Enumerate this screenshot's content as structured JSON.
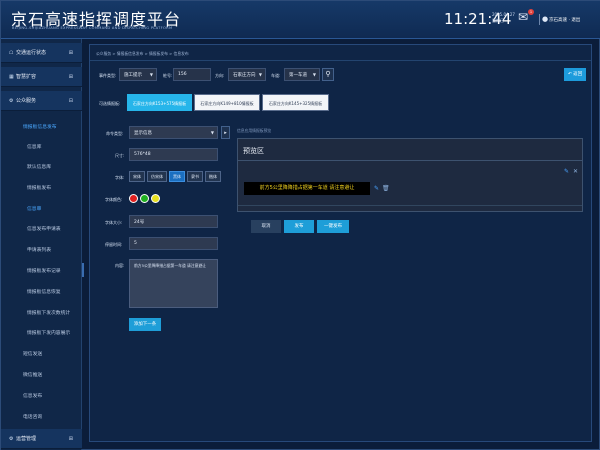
{
  "header": {
    "title": "京石高速指挥调度平台",
    "subtitle": "BEIJING-SHIJIAZHUANG EXPRESSWAY COMMAND AND DISPATCHING PLATFORM",
    "time": "11:21:44",
    "date": "2025.04.27",
    "weekday": "星期日",
    "notification_count": "1",
    "user": "京石高速",
    "logout": "退出"
  },
  "sidebar": {
    "top_items": [
      {
        "icon": "home-icon",
        "label": "交通运行状态",
        "toggle": "⊞"
      },
      {
        "icon": "grid-icon",
        "label": "智慧扩容",
        "toggle": "⊞"
      },
      {
        "icon": "service-icon",
        "label": "公众服务",
        "toggle": "⊟"
      }
    ],
    "section_head": "情报板信息发布",
    "sub_items": [
      "信息库",
      "默认信息库",
      "情报板发布",
      "信息审",
      "信息发布申请表",
      "申请表列表",
      "情报板发布记录",
      "情报板信息恢复",
      "情报板下发次数统计",
      "情报板下发内容展示"
    ],
    "items2": [
      "短信发送",
      "微信推送",
      "信息发布",
      "电话咨询"
    ],
    "bottom_item": {
      "icon": "gear-icon",
      "label": "运营管理",
      "toggle": "⊞"
    }
  },
  "main": {
    "breadcrumb": "公众服务  >  情报板信息发布  >  情报板发布  >  信息发布",
    "filters": {
      "type_label": "事件类型:",
      "type_value": "施工提示",
      "km_label": "桩号:",
      "km_value": "156",
      "dir_label": "方向:",
      "dir_value": "石家庄方向",
      "lane_label": "车道:",
      "lane_value": "第一车道",
      "search_icon": "search-icon"
    },
    "back_label": "返回",
    "board_label": "可选情报板:",
    "boards": [
      "石家庄方向K153+575情报板",
      "石家庄方向K149+810情报板",
      "石家庄方向K145+325情报板"
    ],
    "form": {
      "cmd_label": "命令类型:",
      "cmd_value": "显示信息",
      "size_label": "尺寸:",
      "size_value": "576*48",
      "font_label": "字体:",
      "fonts": [
        "宋体",
        "仿宋体",
        "黑体",
        "隶书",
        "楷体"
      ],
      "color_label": "字体颜色:",
      "colors": [
        "#e02020",
        "#20b020",
        "#e8e020"
      ],
      "font_size_label": "字体大小:",
      "font_size_value": "24号",
      "stay_label": "停留时间:",
      "stay_value": "5",
      "content_label": "内容:",
      "content_value": "前方5公里降降措占据第一车道 请注意避让",
      "add_button": "添加下一条"
    },
    "preview": {
      "caption": "信息应用情报板预览",
      "title": "预览区",
      "led_text": "前方5公里降降措占据第一车道 请注意避让"
    },
    "actions": {
      "cancel": "取消",
      "publish": "发布",
      "one_click": "一键发布"
    }
  }
}
